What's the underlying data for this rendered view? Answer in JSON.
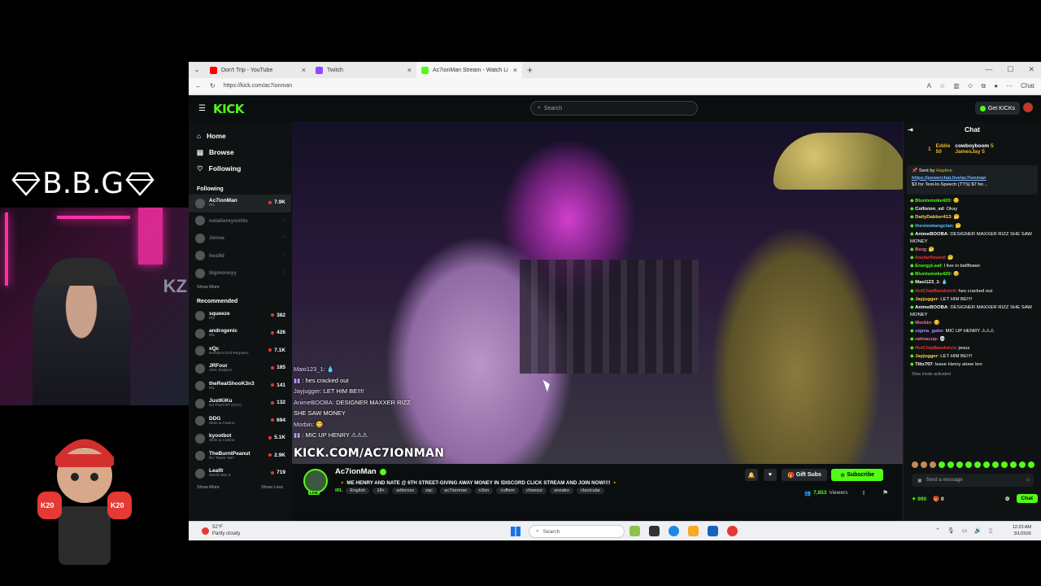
{
  "overlay": {
    "brand_text": "B.B.G",
    "webcam_sign": "KZ",
    "mascot_glove_left": "K20",
    "mascot_glove_right": "K20"
  },
  "browser": {
    "tabs": [
      {
        "label": "Don't Trip - YouTube",
        "icon": "youtube-icon",
        "color": "#ff0000"
      },
      {
        "label": "Twitch",
        "icon": "twitch-icon",
        "color": "#9146ff"
      },
      {
        "label": "Ac7ionMan Stream - Watch Li",
        "icon": "kick-icon",
        "color": "#53fc18",
        "active": true
      }
    ],
    "url": "https://kick.com/ac7ionman",
    "copilot_label": "Chat"
  },
  "kick": {
    "logo": "KICK",
    "search_placeholder": "Search",
    "get_kicks": "Get KICKs",
    "nav": [
      {
        "label": "Home",
        "icon": "home-icon"
      },
      {
        "label": "Browse",
        "icon": "browse-icon"
      },
      {
        "label": "Following",
        "icon": "heart-icon"
      }
    ],
    "following_heading": "Following",
    "following": [
      {
        "name": "Ac7ionMan",
        "category": "IRL",
        "viewers": "7.9K",
        "live": true
      },
      {
        "name": "nataliereynolds",
        "category": "",
        "viewers": "",
        "live": false
      },
      {
        "name": "Jenna",
        "category": "",
        "viewers": "",
        "live": false
      },
      {
        "name": "hes9d",
        "category": "",
        "viewers": "",
        "live": false
      },
      {
        "name": "lilgmoneyy",
        "category": "",
        "viewers": "",
        "live": false
      }
    ],
    "following_show_more": "Show More",
    "recommended_heading": "Recommended",
    "recommended": [
      {
        "name": "squeeze",
        "category": "IRL",
        "viewers": "382"
      },
      {
        "name": "androgenic",
        "category": "IRL",
        "viewers": "426"
      },
      {
        "name": "xQc",
        "category": "Resident Evil Requiem",
        "viewers": "7.1K"
      },
      {
        "name": "JRFour",
        "category": "ARC Raiders",
        "viewers": "185"
      },
      {
        "name": "theRealShooK3n3",
        "category": "IRL",
        "viewers": "141"
      },
      {
        "name": "JustKiKu",
        "category": "No Pixel RP (GTA)",
        "viewers": "132"
      },
      {
        "name": "DDG",
        "category": "Slots & Casino",
        "viewers": "694"
      },
      {
        "name": "kyootbot",
        "category": "Slots & Casino",
        "viewers": "5.1K"
      },
      {
        "name": "TheBurntPeanut",
        "category": "RV There Yet?",
        "viewers": "2.9K"
      },
      {
        "name": "Leafit",
        "category": "World War Z",
        "viewers": "719"
      }
    ],
    "show_more": "Show More",
    "show_less": "Show Less",
    "video_overlay_chat": [
      {
        "user": "Maxi123_1",
        "text": ": 💧"
      },
      {
        "user": "",
        "text": ": hes cracked out"
      },
      {
        "user": "Jayjugger",
        "text": ": LET HIM BE!!!!"
      },
      {
        "user": "AnimeBOOBA",
        "text": ": DESIGNER MAXXER RIZZ"
      },
      {
        "user": "",
        "text": "SHE SAW MONEY"
      },
      {
        "user": "Morbin",
        "text": ": 😋"
      },
      {
        "user": "",
        "text": ": MIC UP HENRY ⚠⚠⚠"
      }
    ],
    "video_watermark": "KICK.COM/AC7IONMAN",
    "streamer": {
      "name": "Ac7ionMan",
      "live_badge": "LIVE",
      "title": "🔸 ME HENRY AND NATE @ 6TH STREET-GIVING AWAY MONEY IN !DISCORD CLICK STREAM AND JOIN NOW!!!! 🔸",
      "category": "IRL",
      "tags": [
        "English",
        "18+",
        "adinross",
        "xqc",
        "ac7ionman",
        "n3on",
        "cuffem",
        "cheesur",
        "sneako",
        "clavicular"
      ],
      "gift_subs": "Gift Subs",
      "subscribe": "Subscribe",
      "viewers": "7,853",
      "viewers_label": "Viewers"
    },
    "chat": {
      "title": "Chat",
      "kings": [
        {
          "rank": "1",
          "name": "Eddie",
          "amount": "50"
        },
        {
          "rank": "",
          "name": "cowboyboom",
          "amount": "5"
        },
        {
          "rank": "",
          "name": "JamesJay",
          "amount": "5"
        }
      ],
      "pinned_from": "Sent by",
      "pinned_user": "Haptive",
      "pinned_link": "https://powerchat.live/ac7ionman",
      "pinned_text": "$3 for Text-to-Speech (TTS) $7 for...",
      "messages": [
        {
          "user": "Bluntsmoke420",
          "color": "gn",
          "text": ": 😏"
        },
        {
          "user": "Collision_xd",
          "color": "wh",
          "text": ": Okay"
        },
        {
          "user": "DailyDabber413",
          "color": "yl",
          "text": ": 🤔"
        },
        {
          "user": "thestewtangclan",
          "color": "bl",
          "text": ": 🤔"
        },
        {
          "user": "AnimeBOOBA",
          "color": "wh",
          "text": ": DESIGNER MAXXER RIZZ SHE SAW MONEY"
        },
        {
          "user": "Bsrg",
          "color": "pk",
          "text": ": 🤔"
        },
        {
          "user": "lioufarflowed",
          "color": "rd",
          "text": ": 🤔"
        },
        {
          "user": "EnergyLeaf",
          "color": "gn",
          "text": ": I live in bellflower"
        },
        {
          "user": "Bluntsmoke420",
          "color": "gn",
          "text": ": 😏"
        },
        {
          "user": "Maxi123_1",
          "color": "wh",
          "text": ": 💧"
        },
        {
          "user": "HolChipBandwick",
          "color": "rd",
          "text": ": hes cracked out"
        },
        {
          "user": "Jayjugger",
          "color": "yl",
          "text": ": LET HIM BE!!!!"
        },
        {
          "user": "AnimeBOOBA",
          "color": "wh",
          "text": ": DESIGNER MAXXER RIZZ SHE SAW MONEY"
        },
        {
          "user": "Morbin",
          "color": "pk",
          "text": ": 😋"
        },
        {
          "user": "sigma_gabe",
          "color": "pu",
          "text": ": MIC UP HENRY ⚠⚠⚠"
        },
        {
          "user": "ratinacup",
          "color": "pk",
          "text": ": 💀"
        },
        {
          "user": "HolChipBandwick",
          "color": "rd",
          "text": ": jesus"
        },
        {
          "user": "Jayjugger",
          "color": "yl",
          "text": ": LET HIM BE!!!!"
        },
        {
          "user": "Tiltz707",
          "color": "wh",
          "text": ": leave Henry alone bro"
        }
      ],
      "slow_mode": "Slow mode activated",
      "send_placeholder": "Send a message",
      "points": "990",
      "gifts": "0",
      "chat_button": "Chat"
    }
  },
  "taskbar": {
    "temp": "52°F",
    "weather": "Partly cloudy",
    "search_placeholder": "Search",
    "time": "12:23 AM",
    "date": "3/1/2026"
  }
}
